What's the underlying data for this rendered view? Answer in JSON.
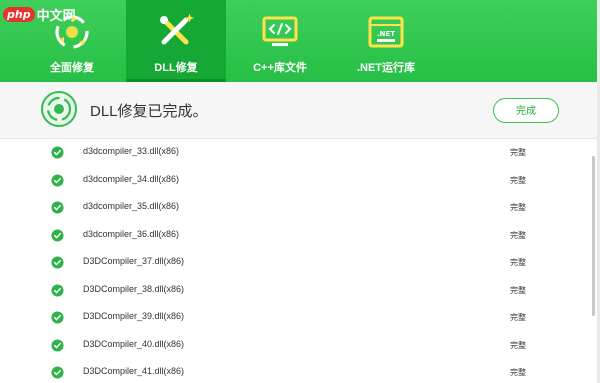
{
  "watermark": {
    "logo": "php",
    "site": "中文网"
  },
  "tabs": [
    {
      "label": "全面修复",
      "icon": "recycle-shield-icon",
      "active": false
    },
    {
      "label": "DLL修复",
      "icon": "wrench-sparkle-icon",
      "active": true
    },
    {
      "label": "C++库文件",
      "icon": "code-monitor-icon",
      "active": false
    },
    {
      "label": ".NET运行库",
      "icon": "dotnet-box-icon",
      "active": false
    }
  ],
  "status": {
    "message": "DLL修复已完成。",
    "done_button": "完成"
  },
  "items": [
    {
      "name": "d3dcompiler_33.dll(x86)",
      "state": "完整"
    },
    {
      "name": "d3dcompiler_34.dll(x86)",
      "state": "完整"
    },
    {
      "name": "d3dcompiler_35.dll(x86)",
      "state": "完整"
    },
    {
      "name": "d3dcompiler_36.dll(x86)",
      "state": "完整"
    },
    {
      "name": "D3DCompiler_37.dll(x86)",
      "state": "完整"
    },
    {
      "name": "D3DCompiler_38.dll(x86)",
      "state": "完整"
    },
    {
      "name": "D3DCompiler_39.dll(x86)",
      "state": "完整"
    },
    {
      "name": "D3DCompiler_40.dll(x86)",
      "state": "完整"
    },
    {
      "name": "D3DCompiler_41.dll(x86)",
      "state": "完整"
    }
  ],
  "colors": {
    "brand_green": "#27bf45",
    "active_tab": "#15a834",
    "check_green": "#2fb24a"
  }
}
